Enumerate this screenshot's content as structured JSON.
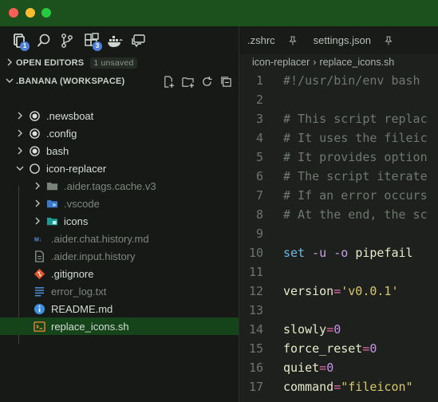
{
  "sidebar": {
    "open_editors": {
      "label": "OPEN EDITORS",
      "badge": "1 unsaved"
    },
    "workspace": {
      "label": ".BANANA (WORKSPACE)"
    },
    "activity_badges": {
      "explorer": "1",
      "extensions": "3"
    },
    "tree": [
      {
        "label": ".newsboat",
        "icon": "dot-circle-icon",
        "type": "folder-collapsed",
        "dim": false
      },
      {
        "label": ".config",
        "icon": "dot-circle-icon",
        "type": "folder-collapsed",
        "dim": false
      },
      {
        "label": "bash",
        "icon": "dot-circle-icon",
        "type": "folder-collapsed",
        "dim": false
      },
      {
        "label": "icon-replacer",
        "icon": "ring-circle-icon",
        "type": "folder-expanded",
        "dim": false
      },
      {
        "label": ".aider.tags.cache.v3",
        "icon": "folder-icon",
        "type": "folder-collapsed",
        "dim": true
      },
      {
        "label": ".vscode",
        "icon": "vscode-folder-icon",
        "type": "folder-collapsed",
        "dim": true
      },
      {
        "label": "icons",
        "icon": "icons-folder-icon",
        "type": "folder-collapsed",
        "dim": false
      },
      {
        "label": ".aider.chat.history.md",
        "icon": "markdown-icon",
        "type": "file",
        "dim": true
      },
      {
        "label": ".aider.input.history",
        "icon": "file-icon",
        "type": "file",
        "dim": true
      },
      {
        "label": ".gitignore",
        "icon": "git-icon",
        "type": "file",
        "dim": false
      },
      {
        "label": "error_log.txt",
        "icon": "text-file-icon",
        "type": "file",
        "dim": true
      },
      {
        "label": "README.md",
        "icon": "info-icon",
        "type": "file",
        "dim": false
      },
      {
        "label": "replace_icons.sh",
        "icon": "shell-icon",
        "type": "file",
        "dim": false,
        "selected": true
      }
    ]
  },
  "editor": {
    "tabs": [
      {
        "label": ".zshrc",
        "pinned": true
      },
      {
        "label": "settings.json",
        "pinned": true
      }
    ],
    "breadcrumb": [
      "icon-replacer",
      "replace_icons.sh"
    ],
    "lines": [
      {
        "n": "1",
        "text": "#!/usr/bin/env bash"
      },
      {
        "n": "2",
        "text": ""
      },
      {
        "n": "3",
        "text": "# This script replac"
      },
      {
        "n": "4",
        "text": "# It uses the fileic"
      },
      {
        "n": "5",
        "text": "# It provides option"
      },
      {
        "n": "6",
        "text": "# The script iterate"
      },
      {
        "n": "7",
        "text": "# If an error occurs"
      },
      {
        "n": "8",
        "text": "# At the end, the sc"
      },
      {
        "n": "9",
        "text": ""
      },
      {
        "n": "10",
        "text": "set -u -o pipefail"
      },
      {
        "n": "11",
        "text": ""
      },
      {
        "n": "12",
        "text": "version='v0.0.1'"
      },
      {
        "n": "13",
        "text": ""
      },
      {
        "n": "14",
        "text": "slowly=0"
      },
      {
        "n": "15",
        "text": "force_reset=0"
      },
      {
        "n": "16",
        "text": "quiet=0"
      },
      {
        "n": "17",
        "text": "command=\"fileicon\""
      }
    ]
  },
  "colors": {
    "titlebar": "#1c501c",
    "selection": "#16441a",
    "accent_badge": "#4f7fd6"
  }
}
